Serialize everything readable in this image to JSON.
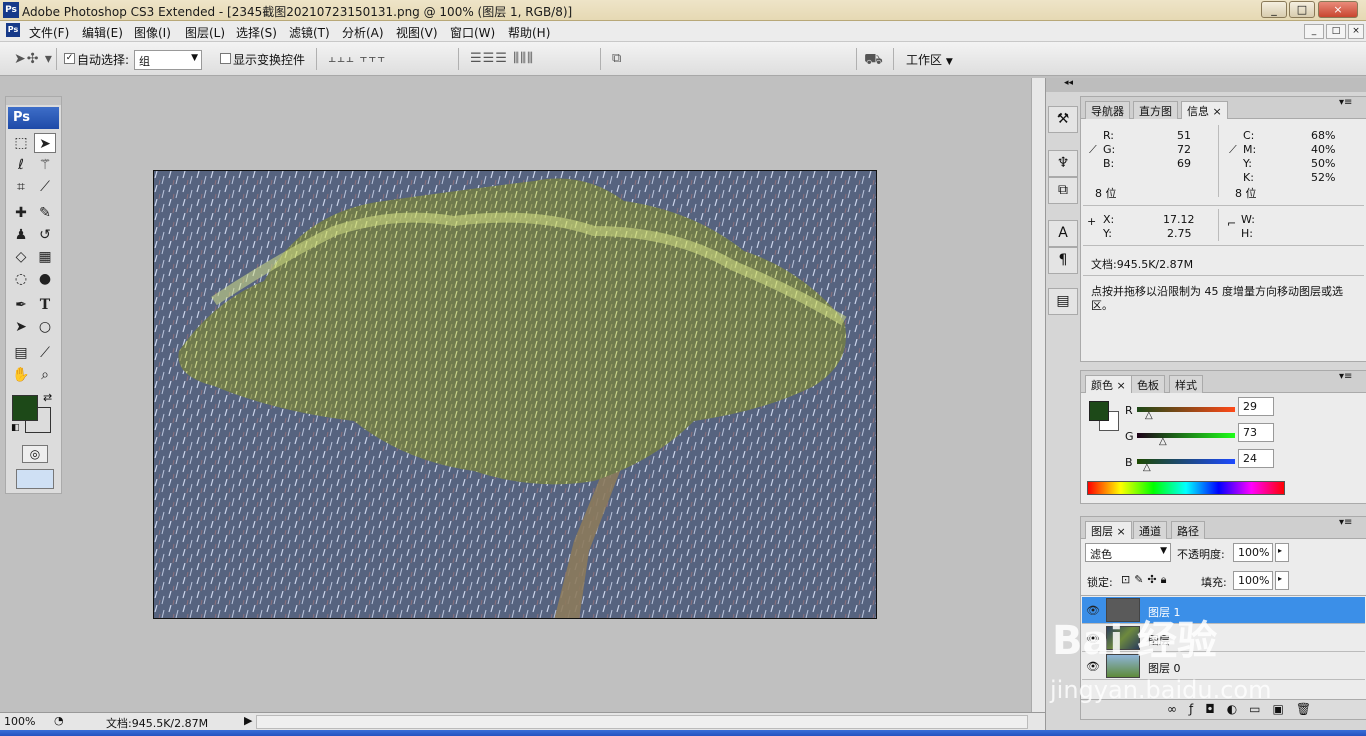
{
  "window": {
    "title": "Adobe Photoshop CS3 Extended - [2345截图20210723150131.png @ 100% (图层 1, RGB/8)]",
    "ps_badge": "Ps",
    "controls": [
      "_",
      "□",
      "×"
    ]
  },
  "menu": [
    "文件(F)",
    "编辑(E)",
    "图像(I)",
    "图层(L)",
    "选择(S)",
    "滤镜(T)",
    "分析(A)",
    "视图(V)",
    "窗口(W)",
    "帮助(H)"
  ],
  "options": {
    "auto_select_label": "自动选择:",
    "auto_select_checked": true,
    "auto_select_value": "组",
    "show_transform_label": "显示变换控件",
    "show_transform_checked": false,
    "workspace_label": "工作区"
  },
  "toolbox": {
    "logo": "Ps",
    "fg_color": "#1d4918",
    "bg_color": "#ffffff"
  },
  "info_panel": {
    "tabs": [
      "导航器",
      "直方图",
      "信息"
    ],
    "active_tab": "信息",
    "rgb": {
      "R": "51",
      "G": "72",
      "B": "69"
    },
    "cmyk": {
      "C": "68%",
      "M": "40%",
      "Y": "50%",
      "K": "52%"
    },
    "bit_left": "8 位",
    "bit_right": "8 位",
    "x_label": "X:",
    "x": "17.12",
    "y_label": "Y:",
    "y": "2.75",
    "w_label": "W:",
    "h_label": "H:",
    "doc": "文档:945.5K/2.87M",
    "hint": "点按并拖移以沿限制为 45 度增量方向移动图层或选区。"
  },
  "color_panel": {
    "tabs": [
      "颜色",
      "色板",
      "样式"
    ],
    "channels": [
      {
        "name": "R",
        "value": "29"
      },
      {
        "name": "G",
        "value": "73"
      },
      {
        "name": "B",
        "value": "24"
      }
    ]
  },
  "layers_panel": {
    "tabs": [
      "图层",
      "通道",
      "路径"
    ],
    "blend_mode": "滤色",
    "opacity_label": "不透明度:",
    "opacity": "100%",
    "lock_label": "锁定:",
    "fill_label": "填充:",
    "fill": "100%",
    "layers": [
      {
        "name": "图层 1",
        "selected": true
      },
      {
        "name": "图层",
        "selected": false
      },
      {
        "name": "图层 0",
        "selected": false
      }
    ]
  },
  "status": {
    "zoom": "100%",
    "doc": "文档:945.5K/2.87M"
  },
  "watermark": {
    "line1": "Bai 经验",
    "line2": "jingyan.baidu.com"
  }
}
